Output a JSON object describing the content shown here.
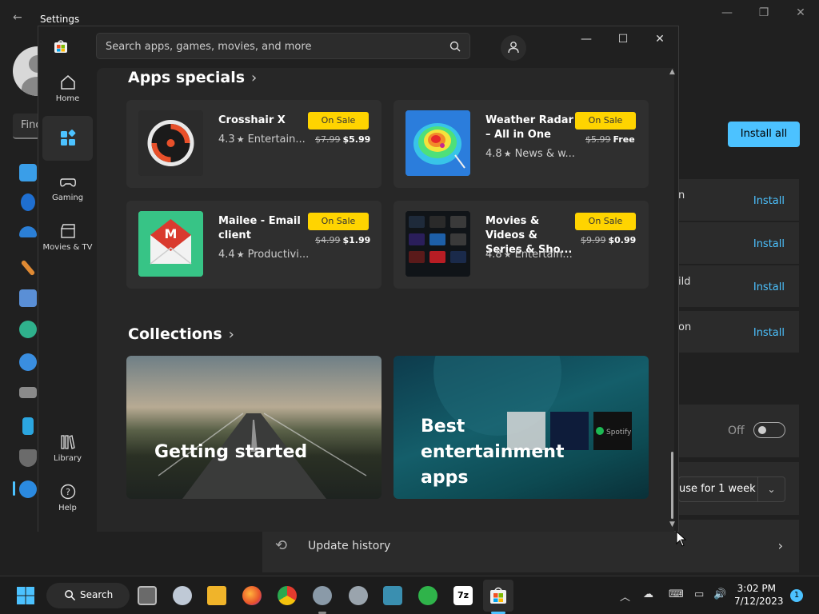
{
  "settings": {
    "title": "Settings",
    "find_placeholder": "Find",
    "install_all_label": "Install all",
    "update_rows": [
      {
        "fragment": "n",
        "action": "Install"
      },
      {
        "fragment": "",
        "action": "Install"
      },
      {
        "fragment": "ild",
        "action": "Install"
      },
      {
        "fragment": "on",
        "action": "Install"
      }
    ],
    "toggle_state": "Off",
    "pause_option": "use for 1 week",
    "update_history_label": "Update history"
  },
  "store": {
    "search_placeholder": "Search apps, games, movies, and more",
    "nav": {
      "home": "Home",
      "gaming": "Gaming",
      "movies": "Movies & TV",
      "library": "Library",
      "help": "Help"
    },
    "apps_specials_title": "Apps specials",
    "collections_title": "Collections",
    "sale_label": "On Sale",
    "apps": [
      {
        "name": "Crosshair X",
        "rating": "4.3",
        "category": "Entertain...",
        "old_price": "$7.99",
        "new_price": "$5.99"
      },
      {
        "name": "Weather Radar – All in One",
        "rating": "4.8",
        "category": "News & w...",
        "old_price": "$5.99",
        "new_price": "Free"
      },
      {
        "name": "Mailee - Email client",
        "rating": "4.4",
        "category": "Productivi...",
        "old_price": "$4.99",
        "new_price": "$1.99"
      },
      {
        "name": "Movies & Videos & Series & Sho...",
        "rating": "4.8",
        "category": "Entertain...",
        "old_price": "$9.99",
        "new_price": "$0.99"
      }
    ],
    "collections": [
      {
        "label": "Getting started"
      },
      {
        "label": "Best entertainment apps"
      }
    ],
    "tile_text": {
      "mail_letter": "M",
      "spotify": "Spotify"
    }
  },
  "taskbar": {
    "search_label": "Search",
    "time": "3:02 PM",
    "date": "7/12/2023",
    "notification_count": "1"
  },
  "colors": {
    "accent": "#4cc2ff",
    "sale_badge": "#ffd400"
  }
}
